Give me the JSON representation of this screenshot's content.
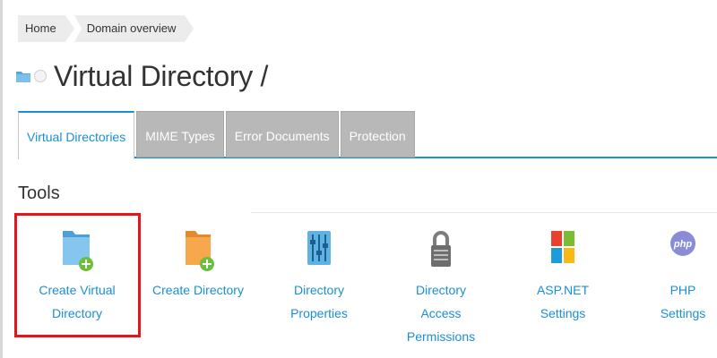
{
  "breadcrumb": {
    "items": [
      "Home",
      "Domain overview"
    ]
  },
  "page": {
    "title": "Virtual Directory /"
  },
  "tabs": [
    {
      "label": "Virtual Directories",
      "active": true
    },
    {
      "label": "MIME Types",
      "active": false
    },
    {
      "label": "Error Documents",
      "active": false
    },
    {
      "label": "Protection",
      "active": false
    }
  ],
  "tools": {
    "heading": "Tools",
    "items": [
      {
        "label": "Create Virtual Directory",
        "icon": "folder-add-icon",
        "highlighted": true
      },
      {
        "label": "Create Directory",
        "icon": "folder-add-icon"
      },
      {
        "label": "Directory Properties",
        "icon": "sliders-icon"
      },
      {
        "label_line1": "Directory Access",
        "label_line2": "Permissions",
        "icon": "lock-icon"
      },
      {
        "label": "ASP.NET Settings",
        "icon": "aspnet-icon"
      },
      {
        "label": "PHP Settings",
        "icon": "php-icon",
        "icon_text": "php"
      }
    ]
  },
  "colors": {
    "accent": "#1a8fd4",
    "highlight": "#e3151d",
    "tab_inactive": "#b8b8b8"
  }
}
